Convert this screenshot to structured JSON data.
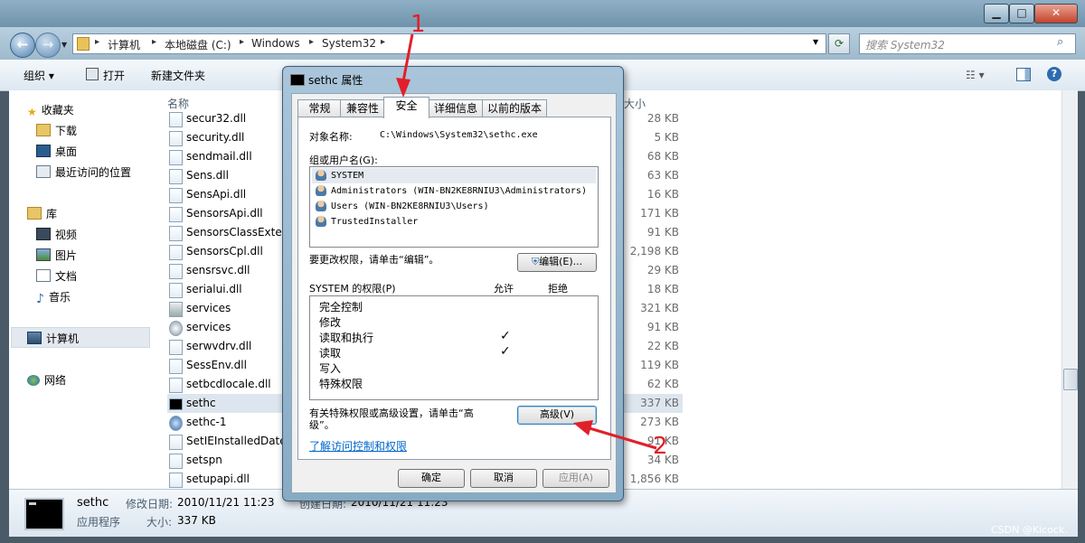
{
  "window": {
    "minimize": "▁",
    "maximize": "□",
    "close": "✕"
  },
  "address": {
    "crumbs": [
      "计算机",
      "本地磁盘 (C:)",
      "Windows",
      "System32"
    ],
    "search_placeholder": "搜索 System32"
  },
  "toolbar": {
    "organize": "组织 ▾",
    "open": "打开",
    "new_folder": "新建文件夹"
  },
  "nav": {
    "favorites": "收藏夹",
    "downloads": "下载",
    "desktop": "桌面",
    "recent": "最近访问的位置",
    "libraries": "库",
    "videos": "视频",
    "pictures": "图片",
    "documents": "文档",
    "music": "音乐",
    "computer": "计算机",
    "network": "网络"
  },
  "columns": {
    "name": "名称",
    "size": "大小"
  },
  "files": [
    {
      "name": "secur32.dll",
      "size": "28 KB"
    },
    {
      "name": "security.dll",
      "size": "5 KB"
    },
    {
      "name": "sendmail.dll",
      "size": "68 KB"
    },
    {
      "name": "Sens.dll",
      "size": "63 KB"
    },
    {
      "name": "SensApi.dll",
      "size": "16 KB"
    },
    {
      "name": "SensorsApi.dll",
      "size": "171 KB"
    },
    {
      "name": "SensorsClassExten",
      "size": "91 KB"
    },
    {
      "name": "SensorsCpl.dll",
      "size": "2,198 KB"
    },
    {
      "name": "sensrsvc.dll",
      "size": "29 KB"
    },
    {
      "name": "serialui.dll",
      "size": "18 KB"
    },
    {
      "name": "services",
      "size": "321 KB"
    },
    {
      "name": "services",
      "size": "91 KB"
    },
    {
      "name": "serwvdrv.dll",
      "size": "22 KB"
    },
    {
      "name": "SessEnv.dll",
      "size": "119 KB"
    },
    {
      "name": "setbcdlocale.dll",
      "size": "62 KB"
    },
    {
      "name": "sethc",
      "size": "337 KB"
    },
    {
      "name": "sethc-1",
      "size": "273 KB"
    },
    {
      "name": "SetIEInstalledDate",
      "size": "91 KB"
    },
    {
      "name": "setspn",
      "size": "34 KB"
    },
    {
      "name": "setupapi.dll",
      "size": "1,856 KB"
    }
  ],
  "details": {
    "name": "sethc",
    "type": "应用程序",
    "modified_label": "修改日期:",
    "modified": "2010/11/21 11:23",
    "created_label": "创建日期:",
    "created": "2010/11/21 11:23",
    "size_label": "大小:",
    "size": "337 KB"
  },
  "dialog": {
    "title": "sethc 属性",
    "tabs": [
      "常规",
      "兼容性",
      "安全",
      "详细信息",
      "以前的版本"
    ],
    "object_label": "对象名称:",
    "object_value": "C:\\Windows\\System32\\sethc.exe",
    "groups_label": "组或用户名(G):",
    "users": [
      "SYSTEM",
      "Administrators (WIN-BN2KE8RNIU3\\Administrators)",
      "Users (WIN-BN2KE8RNIU3\\Users)",
      "TrustedInstaller"
    ],
    "edit_hint": "要更改权限，请单击“编辑”。",
    "edit_button": "编辑(E)...",
    "perm_header": "SYSTEM 的权限(P)",
    "allow": "允许",
    "deny": "拒绝",
    "permissions": [
      {
        "name": "完全控制",
        "allow": ""
      },
      {
        "name": "修改",
        "allow": ""
      },
      {
        "name": "读取和执行",
        "allow": "✓"
      },
      {
        "name": "读取",
        "allow": "✓"
      },
      {
        "name": "写入",
        "allow": ""
      },
      {
        "name": "特殊权限",
        "allow": ""
      }
    ],
    "advanced_hint_1": "有关特殊权限或高级设置，请单击“高",
    "advanced_hint_2": "级”。",
    "advanced_button": "高级(V)",
    "learn_link": "了解访问控制和权限",
    "ok": "确定",
    "cancel": "取消",
    "apply": "应用(A)"
  },
  "annotations": {
    "one": "1",
    "two": "2",
    "color": "#e0202a"
  },
  "watermark": "CSDN @Kicock."
}
